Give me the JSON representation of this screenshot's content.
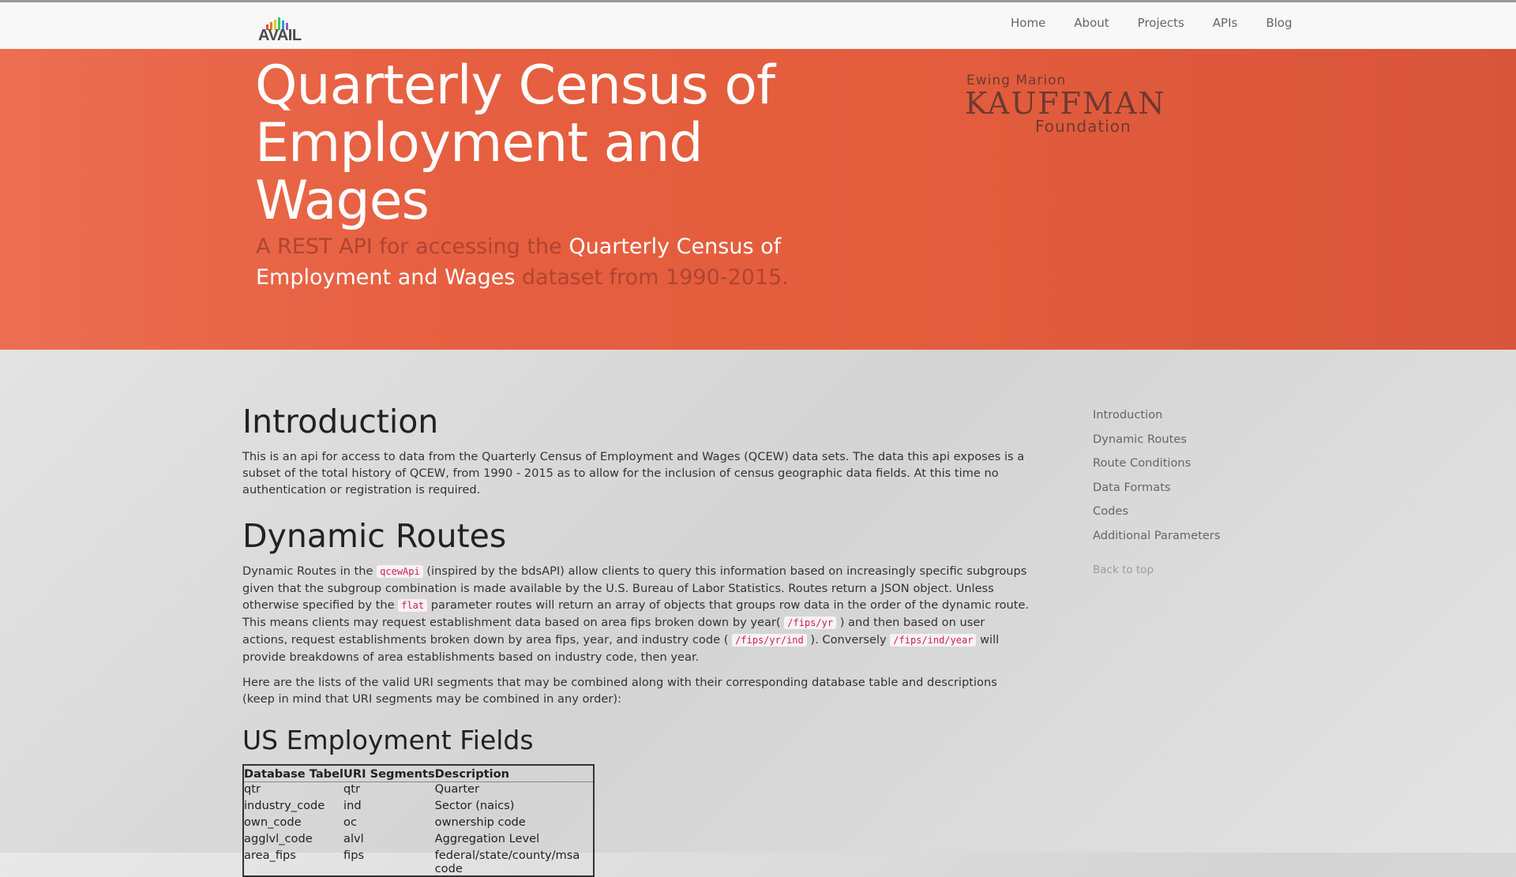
{
  "navbar": {
    "logo_text": "AVAIL",
    "logo_bar_colors": [
      "#e74c3c",
      "#e67e22",
      "#f1c40f",
      "#2ecc71",
      "#3498db",
      "#9b59b6"
    ],
    "links": [
      "Home",
      "About",
      "Projects",
      "APIs",
      "Blog"
    ]
  },
  "hero": {
    "title": "Quarterly Census of Employment and Wages",
    "subtitle_prefix": "A REST API for accessing the ",
    "subtitle_highlight": "Quarterly Census of Employment and Wages",
    "subtitle_suffix": " dataset from 1990-2015.",
    "sponsor": {
      "line1": "Ewing Marion",
      "line2": "KAUFFMAN",
      "line3": "Foundation"
    },
    "colors": {
      "background": "#e35d3d",
      "title": "#ffffff",
      "subtitle": "#b04431"
    }
  },
  "content": {
    "intro": {
      "title": "Introduction",
      "text": "This is an api for access to data from the Quarterly Census of Employment and Wages (QCEW) data sets. The data this api exposes is a subset of the total history of QCEW, from 1990 - 2015 as to allow for the inclusion of census geographic data fields. At this time no authentication or registration is required."
    },
    "dynamic": {
      "title": "Dynamic Routes",
      "p1": {
        "t1": "Dynamic Routes in the ",
        "c1": "qcewApi",
        "t2": " (inspired by the bdsAPI) allow clients to query this information based on increasingly specific subgroups given that the subgroup combination is made available by the U.S. Bureau of Labor Statistics. Routes return a JSON object. Unless otherwise specified by the ",
        "c2": "flat",
        "t3": " parameter routes will return an array of objects that groups row data in the order of the dynamic route. This means clients may request establishment data based on area fips broken down by year( ",
        "c3": "/fips/yr",
        "t4": " ) and then based on user actions, request establishments broken down by area fips, year, and industry code ( ",
        "c4": "/fips/yr/ind",
        "t5": " ). Conversely ",
        "c5": "/fips/ind/year",
        "t6": " will provide breakdowns of area establishments based on industry code, then year."
      },
      "p2": "Here are the lists of the valid URI segments that may be combined along with their corresponding database table and descriptions (keep in mind that URI segments may be combined in any order):"
    },
    "us_fields": {
      "title": "US Employment Fields",
      "headers": [
        "Database Tabel",
        "URI Segments",
        "Description"
      ],
      "rows": [
        [
          "qtr",
          "qtr",
          "Quarter"
        ],
        [
          "industry_code",
          "ind",
          "Sector (naics)"
        ],
        [
          "own_code",
          "oc",
          "ownership code"
        ],
        [
          "agglvl_code",
          "alvl",
          "Aggregation Level"
        ],
        [
          "area_fips",
          "fips",
          "federal/state/county/msa code"
        ]
      ]
    }
  },
  "sidebar": {
    "links": [
      "Introduction",
      "Dynamic Routes",
      "Route Conditions",
      "Data Formats",
      "Codes",
      "Additional Parameters"
    ],
    "back_to_top": "Back to top"
  }
}
